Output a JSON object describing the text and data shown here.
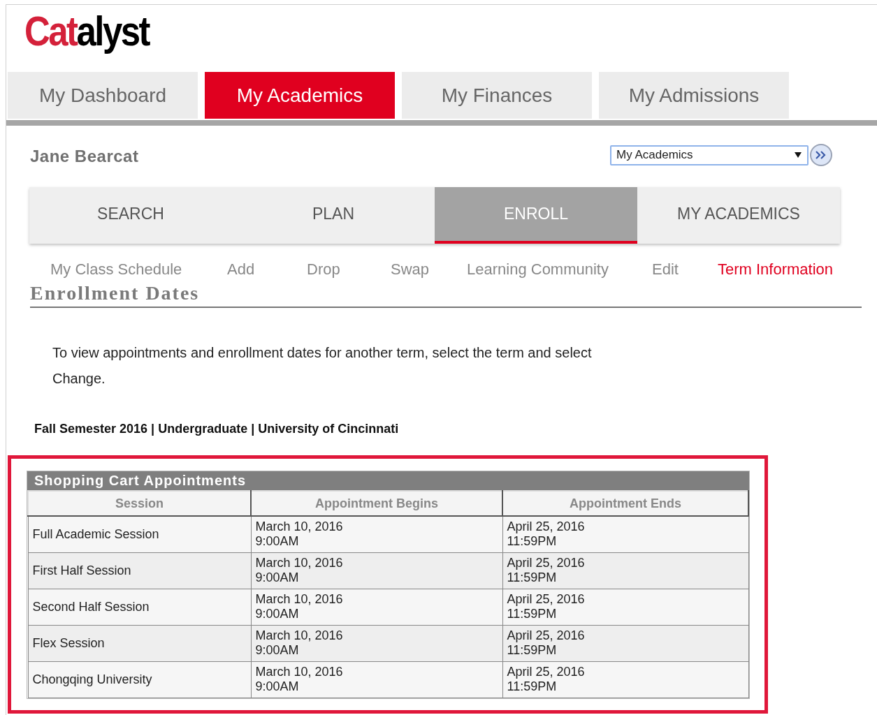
{
  "logo": {
    "red_part": "Cat",
    "dark_part": "alyst"
  },
  "main_tabs": [
    {
      "label": "My Dashboard",
      "selected": false
    },
    {
      "label": "My Academics",
      "selected": true
    },
    {
      "label": "My Finances",
      "selected": false
    },
    {
      "label": "My Admissions",
      "selected": false
    }
  ],
  "student_name": "Jane Bearcat",
  "nav_select": {
    "value": "My Academics"
  },
  "section_tabs": [
    {
      "label": "SEARCH",
      "selected": false
    },
    {
      "label": "PLAN",
      "selected": false
    },
    {
      "label": "ENROLL",
      "selected": true
    },
    {
      "label": "MY ACADEMICS",
      "selected": false
    }
  ],
  "sub_links": [
    {
      "label": "My Class Schedule",
      "selected": false
    },
    {
      "label": "Add",
      "selected": false
    },
    {
      "label": "Drop",
      "selected": false
    },
    {
      "label": "Swap",
      "selected": false
    },
    {
      "label": "Learning Community",
      "selected": false
    },
    {
      "label": "Edit",
      "selected": false
    },
    {
      "label": "Term Information",
      "selected": true
    }
  ],
  "page_title": "Enrollment Dates",
  "instructions": "To view appointments and enrollment dates for another term, select the term and select Change.",
  "term_line": "Fall Semester 2016 | Undergraduate | University of Cincinnati",
  "table": {
    "title": "Shopping Cart Appointments",
    "columns": [
      "Session",
      "Appointment Begins",
      "Appointment Ends"
    ],
    "rows": [
      {
        "session": "Full Academic Session",
        "begins_date": "March 10, 2016",
        "begins_time": "9:00AM",
        "ends_date": "April 25, 2016",
        "ends_time": "11:59PM"
      },
      {
        "session": "First Half Session",
        "begins_date": "March 10, 2016",
        "begins_time": "9:00AM",
        "ends_date": "April 25, 2016",
        "ends_time": "11:59PM"
      },
      {
        "session": "Second Half Session",
        "begins_date": "March 10, 2016",
        "begins_time": "9:00AM",
        "ends_date": "April 25, 2016",
        "ends_time": "11:59PM"
      },
      {
        "session": "Flex Session",
        "begins_date": "March 10, 2016",
        "begins_time": "9:00AM",
        "ends_date": "April 25, 2016",
        "ends_time": "11:59PM"
      },
      {
        "session": "Chongqing University",
        "begins_date": "March 10, 2016",
        "begins_time": "9:00AM",
        "ends_date": "April 25, 2016",
        "ends_time": "11:59PM"
      }
    ]
  }
}
